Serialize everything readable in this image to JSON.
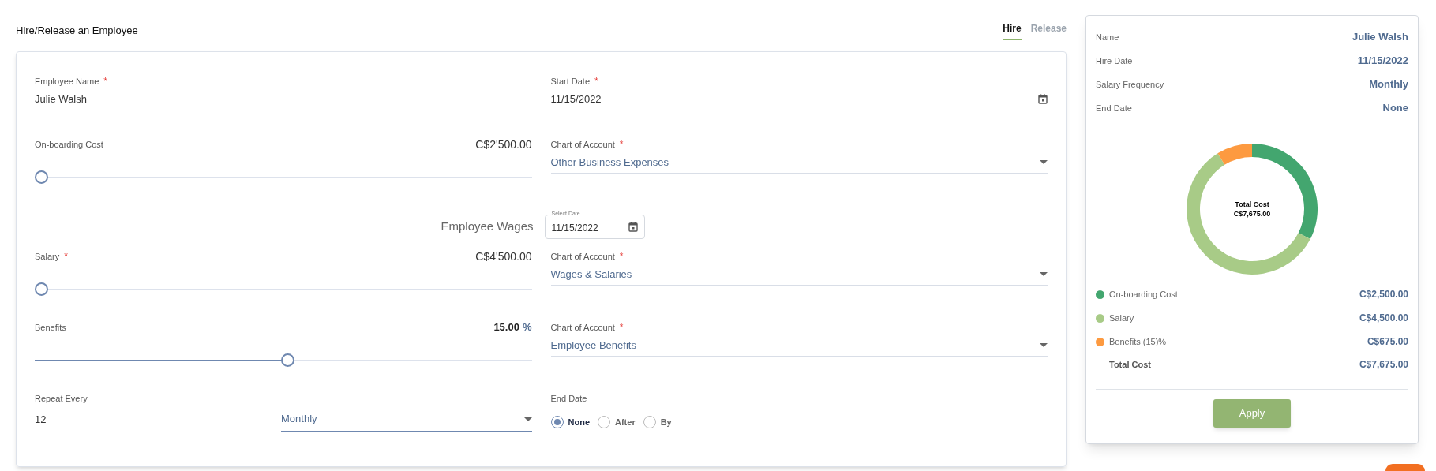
{
  "title": "Hire/Release an Employee",
  "tabs": [
    {
      "label": "Hire",
      "selected": true
    },
    {
      "label": "Release",
      "selected": false
    }
  ],
  "form": {
    "employee_name": {
      "label": "Employee Name",
      "required_mark": "*",
      "value": "Julie Walsh"
    },
    "start_date": {
      "label": "Start Date",
      "required_mark": "*",
      "value": "11/15/2022"
    },
    "onboarding_cost": {
      "label": "On-boarding Cost",
      "amount": "C$2'500.00",
      "level": 0
    },
    "onboarding_account": {
      "label": "Chart of Account",
      "required_mark": "*",
      "value": "Other Business Expenses"
    },
    "wages_heading": "Employee Wages",
    "wages_date": {
      "label": "Select Date",
      "value": "11/15/2022"
    },
    "salary": {
      "label": "Salary",
      "required_mark": "*",
      "amount": "C$4'500.00",
      "level": 0
    },
    "salary_account": {
      "label": "Chart of Account",
      "required_mark": "*",
      "value": "Wages & Salaries"
    },
    "benefits": {
      "label": "Benefits",
      "amount": "15.00",
      "unit": "%",
      "level": 0.51
    },
    "benefits_account": {
      "label": "Chart of Account",
      "required_mark": "*",
      "value": "Employee Benefits"
    },
    "repeat_every": {
      "label": "Repeat Every",
      "value": "12"
    },
    "repeat_unit": {
      "value": "Monthly"
    },
    "end_date": {
      "label": "End Date",
      "options": [
        {
          "label": "None",
          "selected": true
        },
        {
          "label": "After",
          "selected": false
        },
        {
          "label": "By",
          "selected": false
        }
      ]
    }
  },
  "summary": {
    "rows": [
      {
        "label": "Name",
        "value": "Julie Walsh"
      },
      {
        "label": "Hire Date",
        "value": "11/15/2022"
      },
      {
        "label": "Salary Frequency",
        "value": "Monthly"
      },
      {
        "label": "End Date",
        "value": "None"
      }
    ],
    "chart_data": {
      "type": "donut",
      "categories": [
        "On-boarding Cost",
        "Salary",
        "Benefits (15)%"
      ],
      "series": [
        {
          "name": "Total Cost",
          "values": [
            32.57,
            58.63,
            8.8
          ]
        }
      ]
    },
    "center_value": "C$7,675.00",
    "legend": [
      {
        "value": "C$2,500.00",
        "color": "#43a66f"
      },
      {
        "value": "C$4,500.00",
        "color": "#a8cb87"
      },
      {
        "value": "C$675.00",
        "color": "#fd9a40"
      }
    ],
    "total": {
      "label": "Total Cost",
      "value": "C$7,675.00"
    },
    "button": "Apply"
  }
}
